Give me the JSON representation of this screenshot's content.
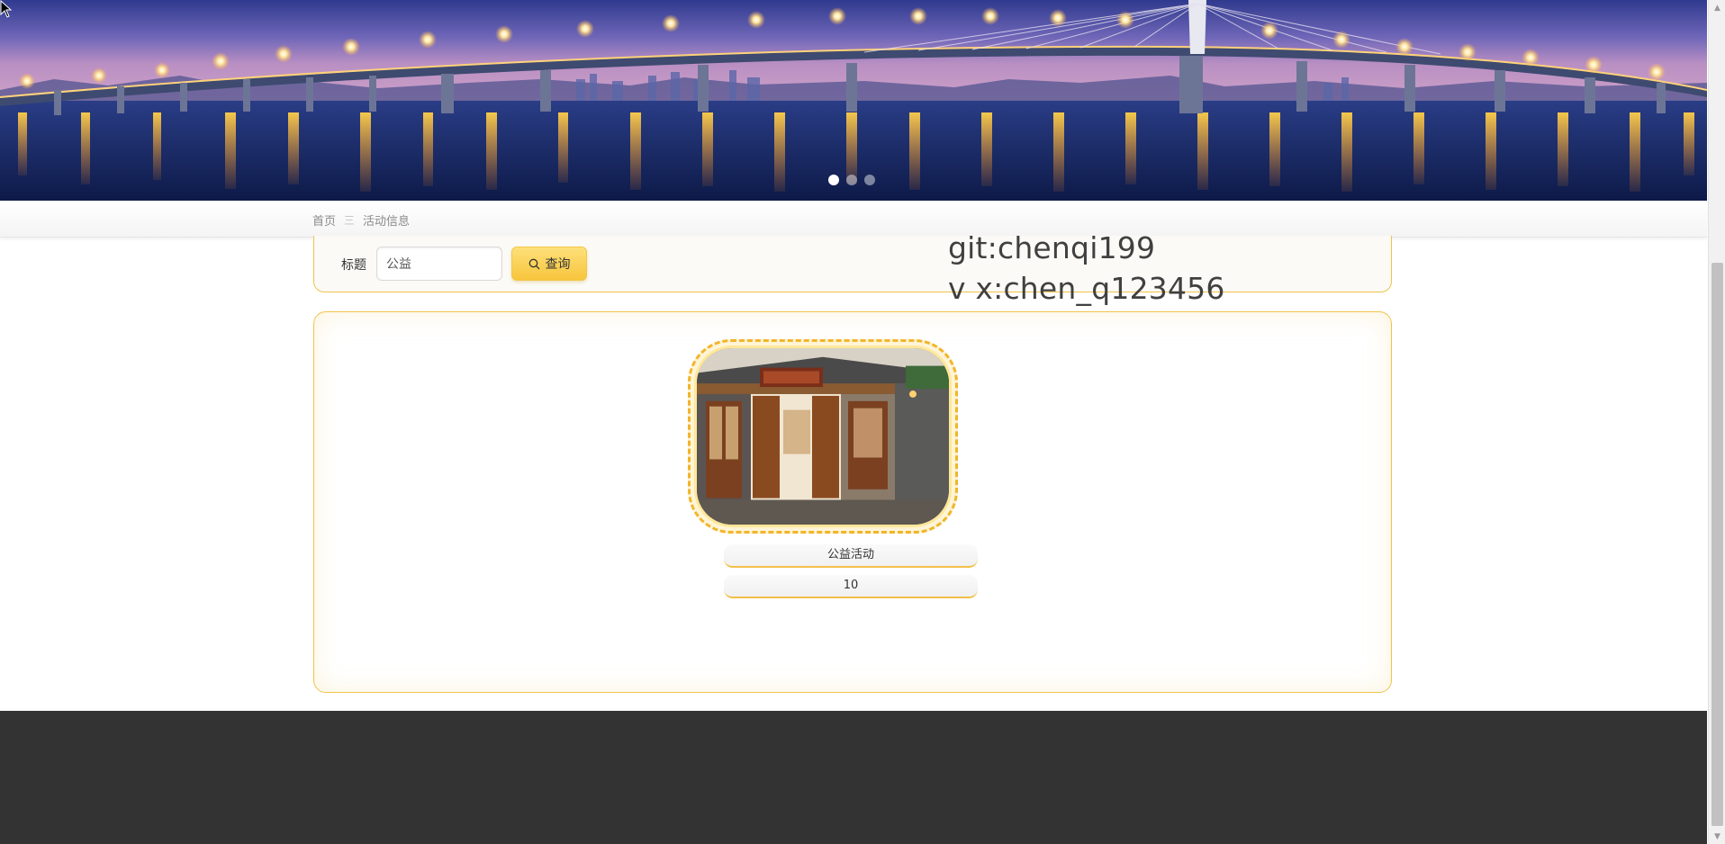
{
  "banner": {
    "slides": [
      "slide-1",
      "slide-2",
      "slide-3"
    ],
    "active_slide": 1
  },
  "breadcrumb": {
    "home": "首页",
    "separator": "三",
    "current": "活动信息"
  },
  "search": {
    "label": "标题",
    "value": "公益",
    "button_label": "查询",
    "button_icon": "search-icon"
  },
  "watermark": {
    "line1": "git:chenqi199",
    "line2": "v x:chen_q123456"
  },
  "items": [
    {
      "title": "公益活动",
      "count": "10",
      "photo": "storefront-photo"
    }
  ],
  "colors": {
    "accent": "#f7c53c",
    "border": "#f0c34b",
    "footer": "#333333"
  }
}
